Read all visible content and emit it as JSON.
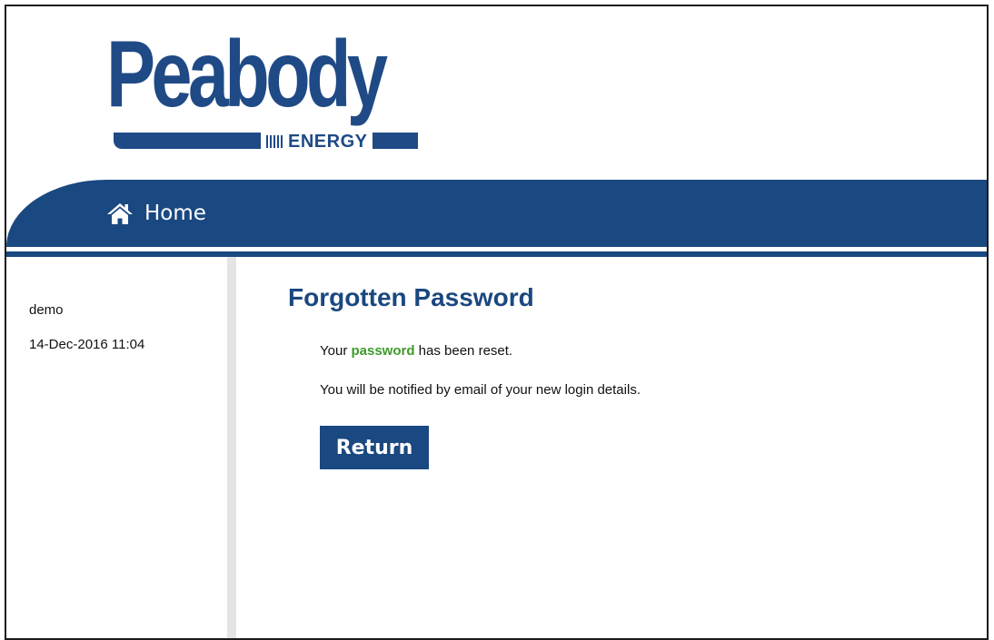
{
  "logo": {
    "wordmark": "Peabody",
    "subtitle": "ENERGY"
  },
  "nav": {
    "home_label": "Home",
    "home_icon": "home-icon"
  },
  "sidebar": {
    "username": "demo",
    "datetime": "14-Dec-2016 11:04"
  },
  "main": {
    "title": "Forgotten Password",
    "message_prefix": "Your ",
    "message_highlight": "password",
    "message_suffix": " has been reset.",
    "notice": "You will be notified by email of your new login details.",
    "return_label": "Return"
  },
  "colors": {
    "brand_blue": "#1a4880",
    "highlight_green": "#3e9a2a",
    "divider_gray": "#e4e4e4"
  }
}
